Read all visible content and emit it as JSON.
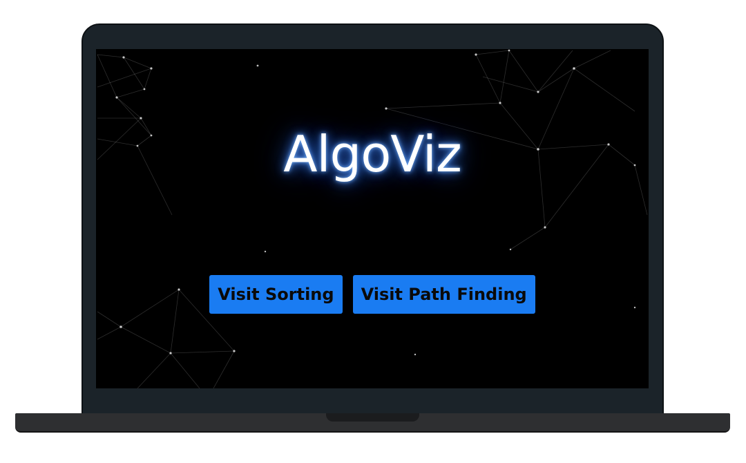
{
  "app": {
    "title": "AlgoViz"
  },
  "actions": {
    "sorting_label": "Visit Sorting",
    "path_finding_label": "Visit Path Finding"
  },
  "colors": {
    "button_bg": "#1a7cf2",
    "title_glow": "#468cff",
    "background": "#000000",
    "device_frame": "#1b2329"
  }
}
